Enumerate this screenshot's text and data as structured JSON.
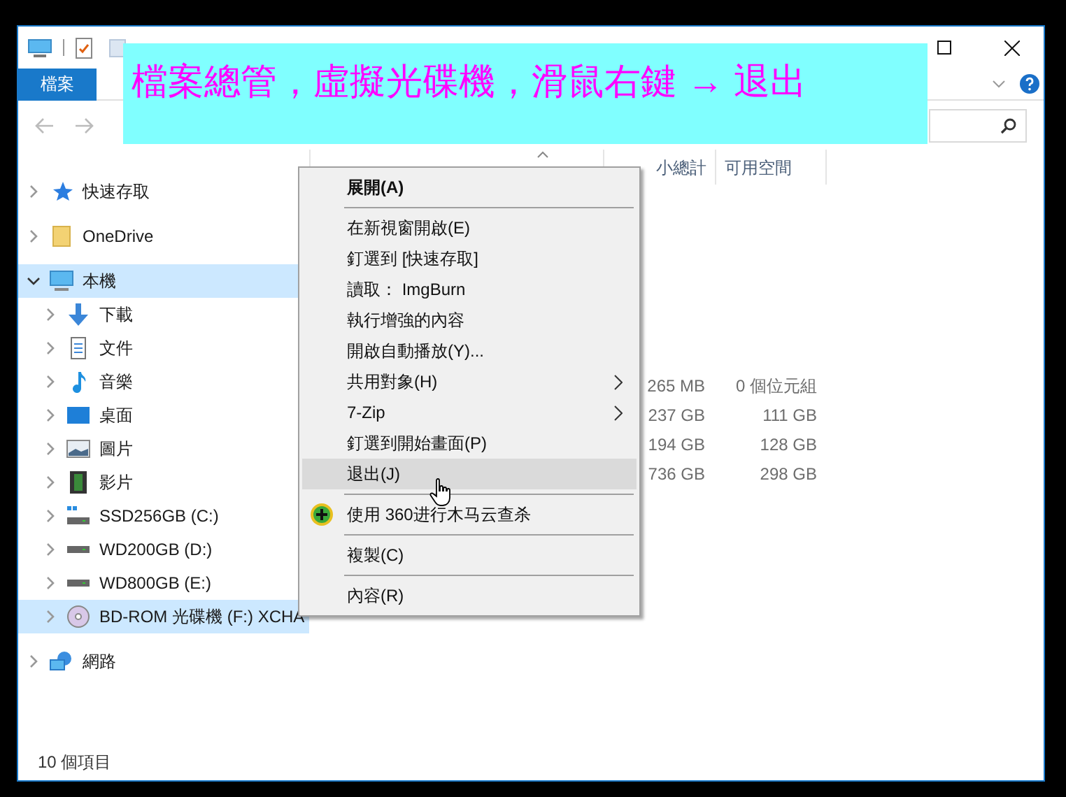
{
  "banner": {
    "text": "檔案總管，虛擬光碟機，滑鼠右鍵 → 退出"
  },
  "ribbon": {
    "tabs": [
      {
        "label": "檔案",
        "selected": true
      }
    ]
  },
  "navigation": {
    "items": [
      {
        "label": "快速存取",
        "kind": "star",
        "expanded": false,
        "selected": false
      },
      {
        "label": "OneDrive",
        "kind": "folder",
        "expanded": false,
        "selected": false
      },
      {
        "label": "本機",
        "kind": "computer",
        "expanded": true,
        "selected": true,
        "children": [
          {
            "label": "下載",
            "kind": "download",
            "expanded": false,
            "selected": false
          },
          {
            "label": "文件",
            "kind": "document",
            "expanded": false,
            "selected": false
          },
          {
            "label": "音樂",
            "kind": "music",
            "expanded": false,
            "selected": false
          },
          {
            "label": "桌面",
            "kind": "desktop",
            "expanded": false,
            "selected": false
          },
          {
            "label": "圖片",
            "kind": "pictures",
            "expanded": false,
            "selected": false
          },
          {
            "label": "影片",
            "kind": "video",
            "expanded": false,
            "selected": false
          },
          {
            "label": "SSD256GB (C:)",
            "kind": "system-drive",
            "expanded": false,
            "selected": false
          },
          {
            "label": "WD200GB (D:)",
            "kind": "drive",
            "expanded": false,
            "selected": false
          },
          {
            "label": "WD800GB (E:)",
            "kind": "drive",
            "expanded": false,
            "selected": false
          },
          {
            "label": "BD-ROM 光碟機 (F:) XCHA",
            "kind": "disc",
            "expanded": false,
            "selected": true
          }
        ]
      },
      {
        "label": "網路",
        "kind": "network",
        "expanded": false,
        "selected": false
      }
    ]
  },
  "columns": [
    "小總計",
    "可用空間"
  ],
  "drives": [
    {
      "total": "265 MB",
      "free": "0 個位元組"
    },
    {
      "total": "237 GB",
      "free": "111 GB"
    },
    {
      "total": "194 GB",
      "free": "128 GB"
    },
    {
      "total": "736 GB",
      "free": "298 GB"
    }
  ],
  "context_menu": {
    "items": [
      {
        "kind": "item",
        "label": "展開(A)",
        "default": true,
        "submenu": false,
        "selected": false
      },
      {
        "kind": "separator"
      },
      {
        "kind": "item",
        "label": "在新視窗開啟(E)",
        "default": false,
        "submenu": false,
        "selected": false
      },
      {
        "kind": "item",
        "label": "釘選到 [快速存取]",
        "default": false,
        "submenu": false,
        "selected": false
      },
      {
        "kind": "item",
        "label": "讀取： ImgBurn",
        "default": false,
        "submenu": false,
        "selected": false
      },
      {
        "kind": "item",
        "label": "執行增強的內容",
        "default": false,
        "submenu": false,
        "selected": false
      },
      {
        "kind": "item",
        "label": "開啟自動播放(Y)...",
        "default": false,
        "submenu": false,
        "selected": false
      },
      {
        "kind": "item",
        "label": "共用對象(H)",
        "default": false,
        "submenu": true,
        "selected": false
      },
      {
        "kind": "item",
        "label": "7-Zip",
        "default": false,
        "submenu": true,
        "selected": false
      },
      {
        "kind": "item",
        "label": "釘選到開始畫面(P)",
        "default": false,
        "submenu": false,
        "selected": false
      },
      {
        "kind": "item",
        "label": "退出(J)",
        "default": false,
        "submenu": false,
        "selected": true
      },
      {
        "kind": "separator"
      },
      {
        "kind": "icon-item",
        "label": "使用 360进行木马云查杀",
        "default": false,
        "submenu": false,
        "selected": false
      },
      {
        "kind": "separator"
      },
      {
        "kind": "item",
        "label": "複製(C)",
        "default": false,
        "submenu": false,
        "selected": false
      },
      {
        "kind": "separator"
      },
      {
        "kind": "item",
        "label": "內容(R)",
        "default": false,
        "submenu": false,
        "selected": false
      }
    ]
  },
  "status_bar": {
    "text": "10 個項目"
  }
}
